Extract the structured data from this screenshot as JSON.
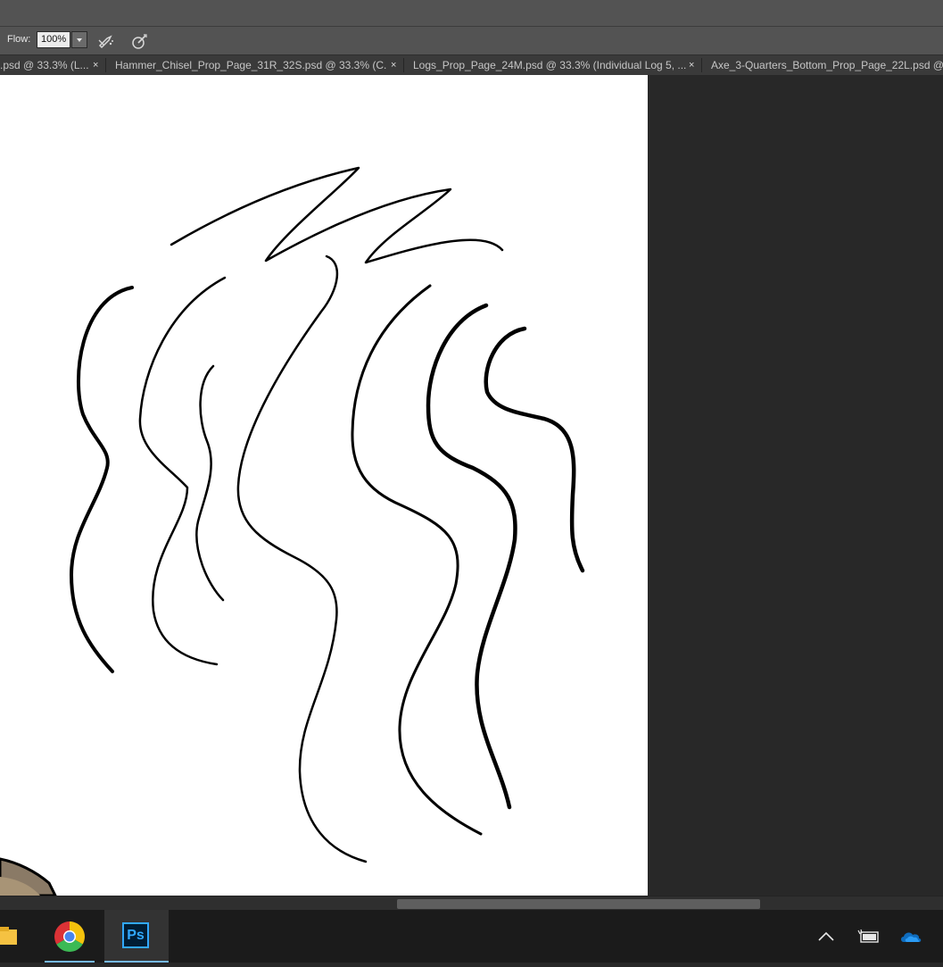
{
  "options_bar": {
    "flow_label": "Flow:",
    "flow_value": "100%"
  },
  "tabs": [
    {
      "label": ".psd @ 33.3% (L...",
      "close": "×"
    },
    {
      "label": "Hammer_Chisel_Prop_Page_31R_32S.psd @ 33.3% (C...",
      "close": "×"
    },
    {
      "label": "Logs_Prop_Page_24M.psd @ 33.3% (Individual Log 5, ...",
      "close": "×"
    },
    {
      "label": "Axe_3-Quarters_Bottom_Prop_Page_22L.psd @",
      "close": ""
    }
  ],
  "taskbar": {
    "apps": [
      "file-explorer",
      "chrome",
      "photoshop"
    ],
    "ps_label": "Ps",
    "active_app": "photoshop"
  },
  "tray": [
    "chevron-up-icon",
    "battery-plug-icon",
    "onedrive-cloud-icon"
  ],
  "colors": {
    "ui_dark": "#535353",
    "workspace": "#282828",
    "canvas": "#ffffff",
    "ps_blue": "#31a8ff",
    "taskbar_accent": "#76b9ed"
  }
}
